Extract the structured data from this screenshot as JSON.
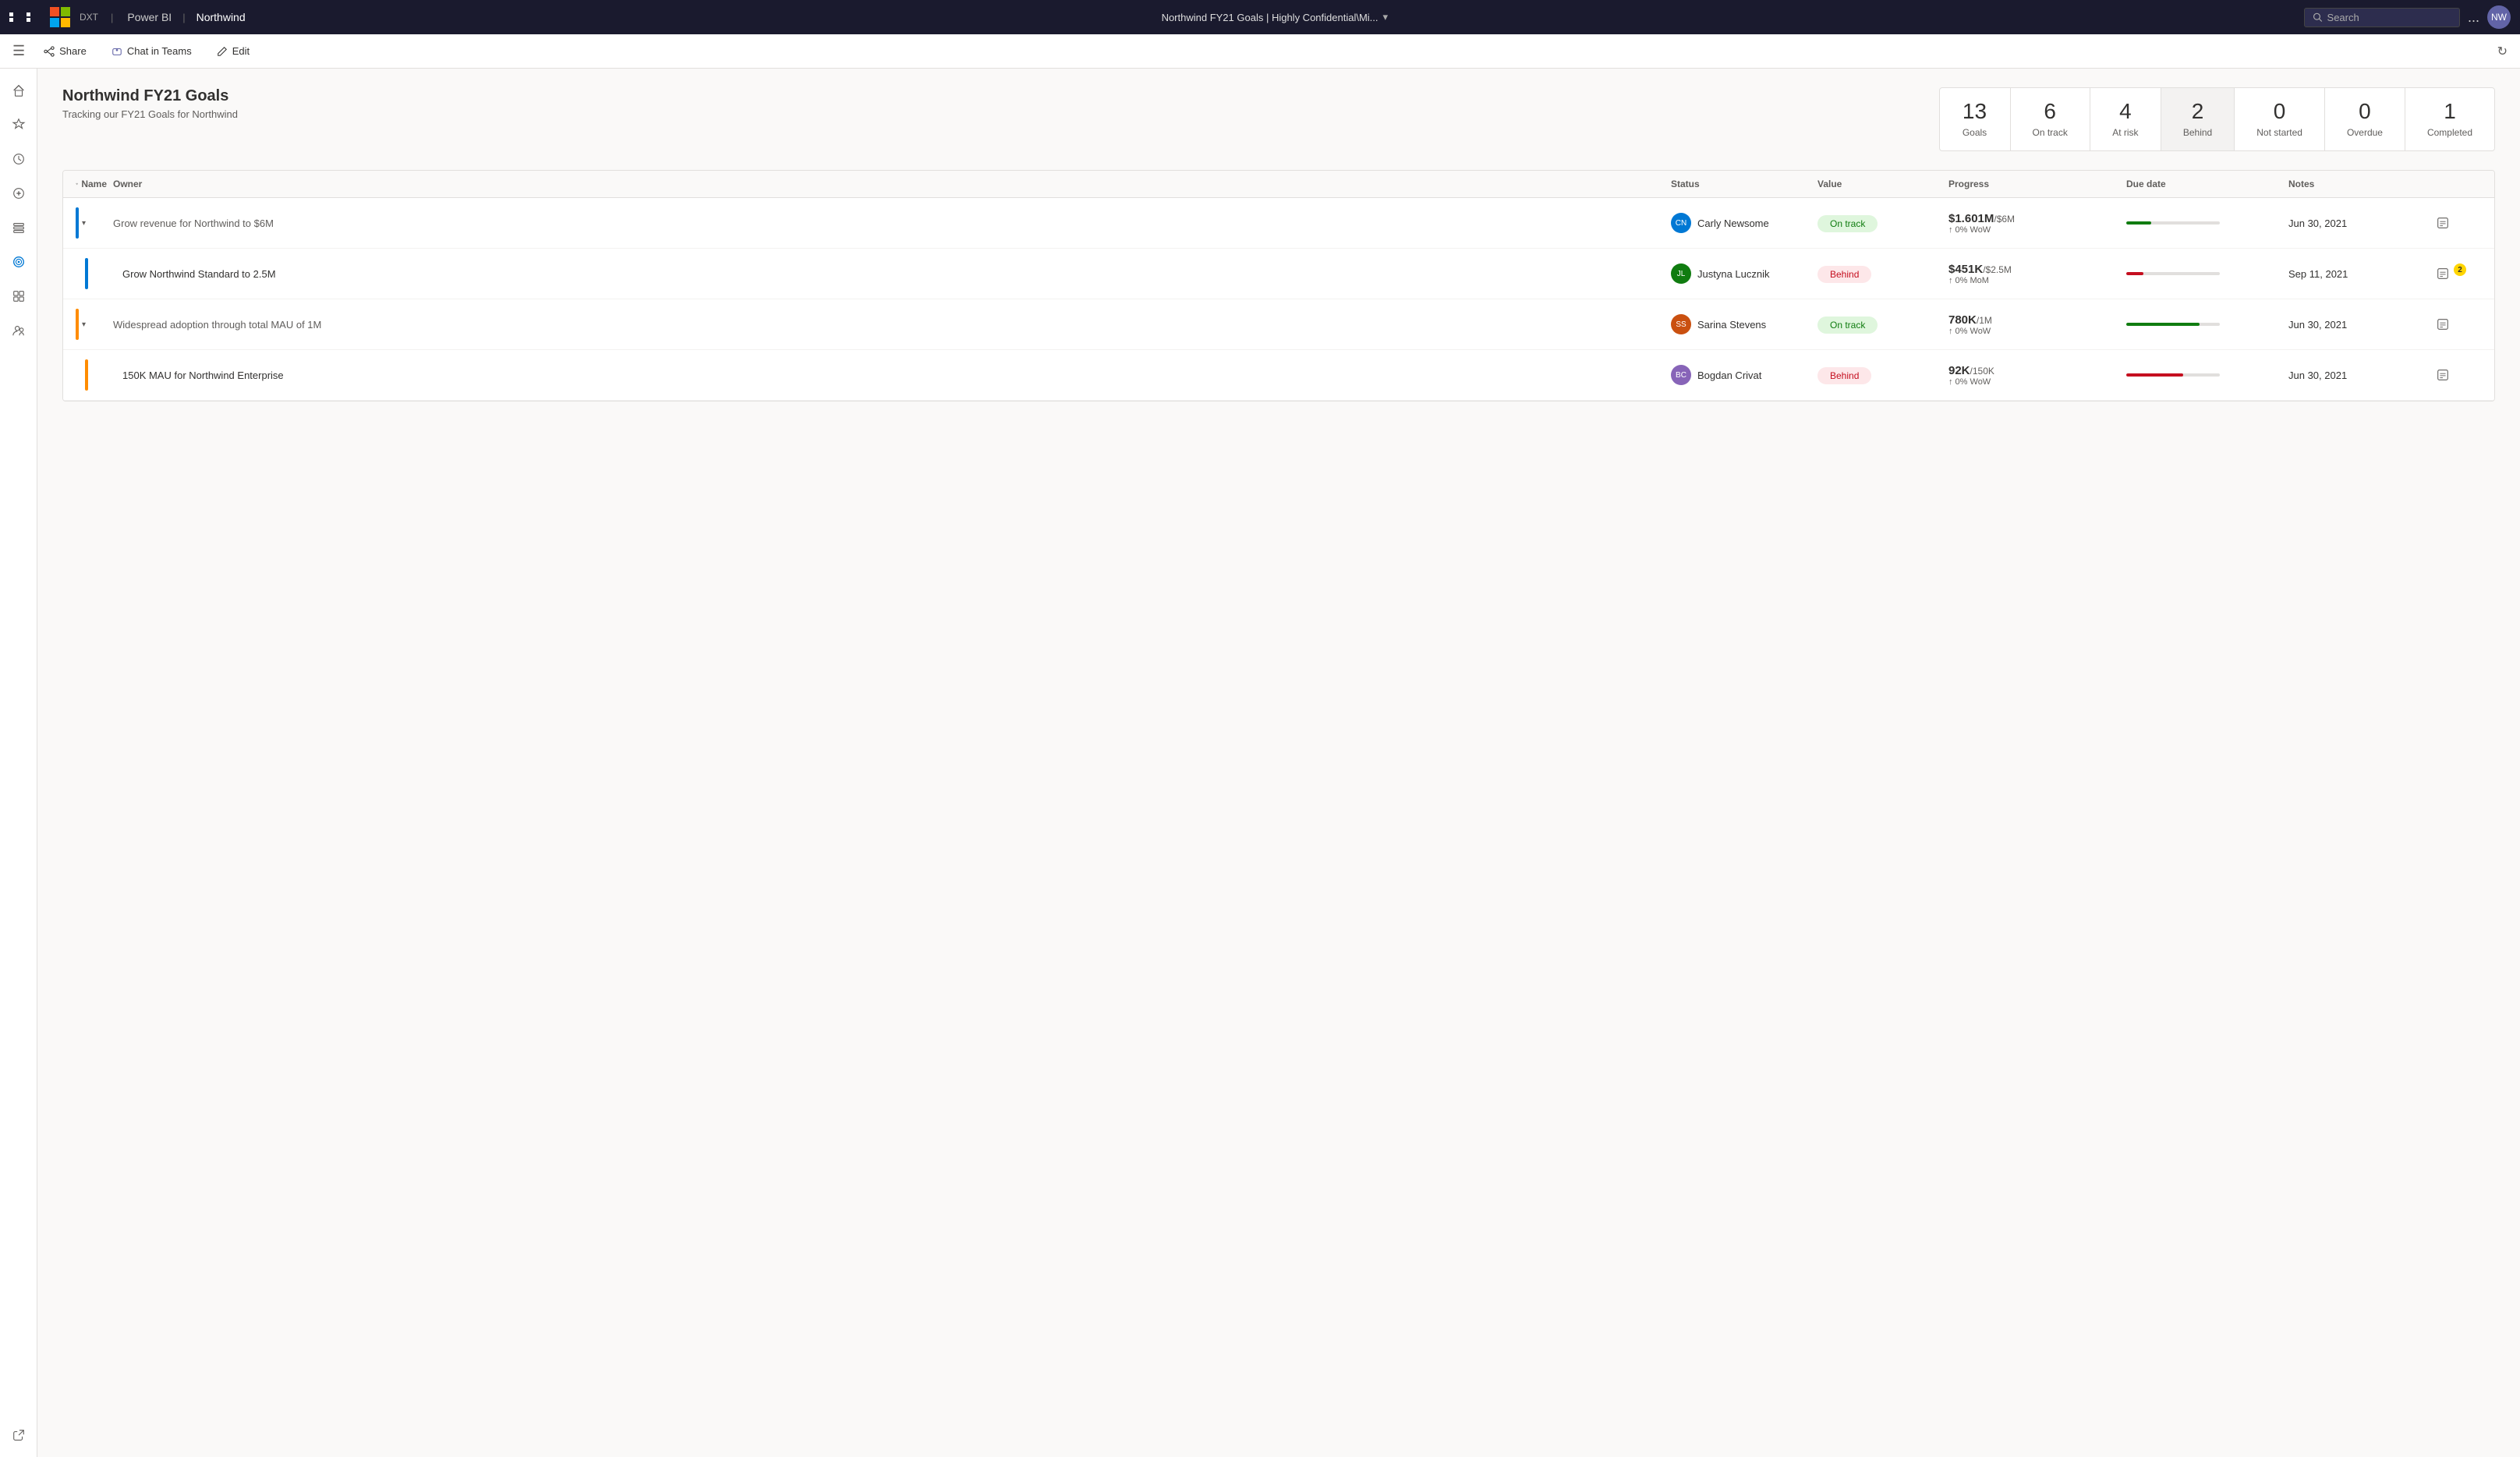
{
  "topNav": {
    "brand": "Power BI",
    "workspace": "Northwind",
    "docTitle": "Northwind FY21 Goals  |  Highly Confidential\\Mi...",
    "searchPlaceholder": "Search",
    "moreLabel": "...",
    "avatarInitials": "NW"
  },
  "subNav": {
    "shareLabel": "Share",
    "chatLabel": "Chat in Teams",
    "editLabel": "Edit"
  },
  "page": {
    "title": "Northwind FY21 Goals",
    "subtitle": "Tracking our FY21 Goals for Northwind"
  },
  "statCards": [
    {
      "number": "13",
      "label": "Goals",
      "active": false
    },
    {
      "number": "6",
      "label": "On track",
      "active": false
    },
    {
      "number": "4",
      "label": "At risk",
      "active": false
    },
    {
      "number": "2",
      "label": "Behind",
      "active": true
    },
    {
      "number": "0",
      "label": "Not started",
      "active": false
    },
    {
      "number": "0",
      "label": "Overdue",
      "active": false
    },
    {
      "number": "1",
      "label": "Completed",
      "active": false
    }
  ],
  "tableHeaders": {
    "filter": "filter",
    "name": "Name",
    "owner": "Owner",
    "status": "Status",
    "value": "Value",
    "progress": "Progress",
    "dueDate": "Due date",
    "notes": "Notes"
  },
  "rows": [
    {
      "id": "row1",
      "level": "parent",
      "expanded": true,
      "indicator": "blue",
      "name": "Grow revenue for Northwind to $6M",
      "nameGrayed": true,
      "ownerAvatar": "CN",
      "ownerName": "Carly Newsome",
      "status": "On track",
      "statusType": "on-track",
      "valueMain": "$1.601M",
      "valueTarget": "/$6M",
      "valueChange": "↑ 0% WoW",
      "progressPct": 27,
      "progressType": "green",
      "dueDate": "Jun 30, 2021",
      "notesCount": 0
    },
    {
      "id": "row2",
      "level": "child",
      "indicator": "blue",
      "name": "Grow Northwind Standard to 2.5M",
      "nameGrayed": false,
      "ownerAvatar": "JL",
      "ownerName": "Justyna Lucznik",
      "status": "Behind",
      "statusType": "behind",
      "valueMain": "$451K",
      "valueTarget": "/$2.5M",
      "valueChange": "↑ 0% MoM",
      "progressPct": 18,
      "progressType": "red",
      "dueDate": "Sep 11, 2021",
      "notesCount": 2
    },
    {
      "id": "row3",
      "level": "parent",
      "expanded": true,
      "indicator": "orange",
      "name": "Widespread adoption through total MAU of 1M",
      "nameGrayed": true,
      "ownerAvatar": "SS",
      "ownerName": "Sarina Stevens",
      "status": "On track",
      "statusType": "on-track",
      "valueMain": "780K",
      "valueTarget": "/1M",
      "valueChange": "↑ 0% WoW",
      "progressPct": 78,
      "progressType": "green",
      "dueDate": "Jun 30, 2021",
      "notesCount": 0
    },
    {
      "id": "row4",
      "level": "child",
      "indicator": "orange",
      "name": "150K MAU for Northwind Enterprise",
      "nameGrayed": false,
      "ownerAvatar": "BC",
      "ownerName": "Bogdan Crivat",
      "status": "Behind",
      "statusType": "behind",
      "valueMain": "92K",
      "valueTarget": "/150K",
      "valueChange": "↑ 0% WoW",
      "progressPct": 61,
      "progressType": "red",
      "dueDate": "Jun 30, 2021",
      "notesCount": 0
    }
  ],
  "sidebar": {
    "icons": [
      "☰",
      "⭐",
      "🕐",
      "➕",
      "📋",
      "🏆",
      "📊",
      "👥",
      "🚀",
      "📦",
      "🌐"
    ]
  }
}
